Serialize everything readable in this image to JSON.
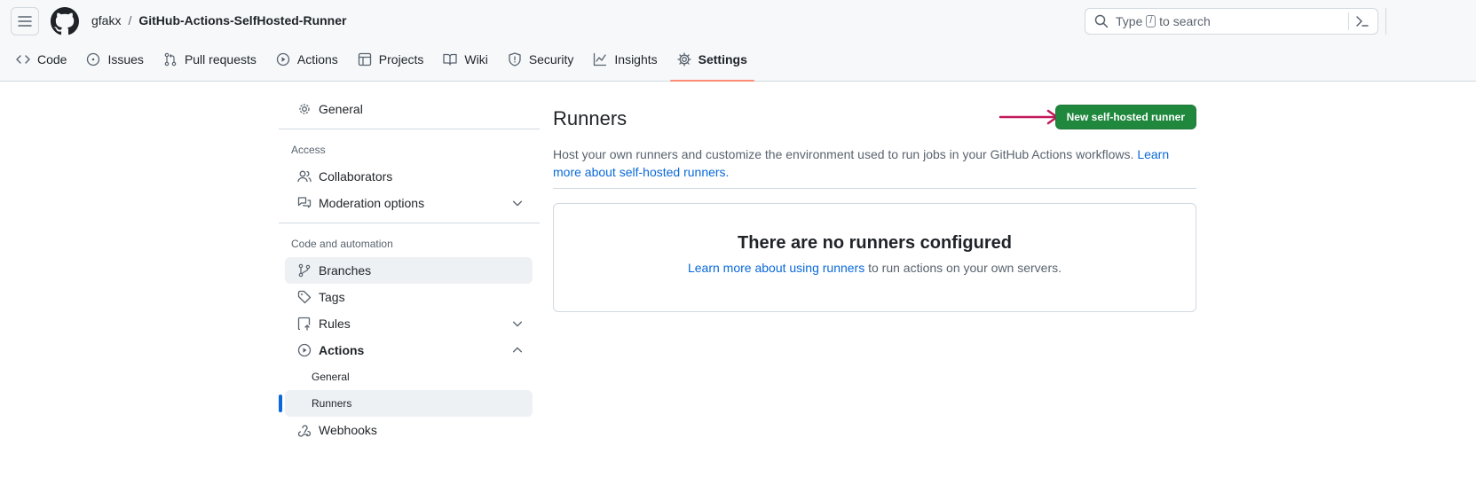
{
  "header": {
    "owner": "gfakx",
    "separator": "/",
    "repo": "GitHub-Actions-SelfHosted-Runner",
    "search": {
      "prefix": "Type",
      "key": "/",
      "suffix": "to search"
    }
  },
  "tabs": [
    {
      "label": "Code",
      "icon": "code-icon"
    },
    {
      "label": "Issues",
      "icon": "issue-icon"
    },
    {
      "label": "Pull requests",
      "icon": "pull-request-icon"
    },
    {
      "label": "Actions",
      "icon": "play-icon"
    },
    {
      "label": "Projects",
      "icon": "table-icon"
    },
    {
      "label": "Wiki",
      "icon": "book-icon"
    },
    {
      "label": "Security",
      "icon": "shield-icon"
    },
    {
      "label": "Insights",
      "icon": "graph-icon"
    },
    {
      "label": "Settings",
      "icon": "gear-icon",
      "active": true
    }
  ],
  "sidebar": {
    "general": "General",
    "access_heading": "Access",
    "collaborators": "Collaborators",
    "moderation": "Moderation options",
    "code_heading": "Code and automation",
    "branches": "Branches",
    "tags": "Tags",
    "rules": "Rules",
    "actions": "Actions",
    "actions_general": "General",
    "actions_runners": "Runners",
    "webhooks": "Webhooks"
  },
  "main": {
    "title": "Runners",
    "new_button": "New self-hosted runner",
    "description": "Host your own runners and customize the environment used to run jobs in your GitHub Actions workflows.",
    "description_link": "Learn more about self-hosted runners.",
    "empty_title": "There are no runners configured",
    "empty_link": "Learn more about using runners",
    "empty_suffix": "to run actions on your own servers."
  },
  "colors": {
    "primary_button": "#1f883d",
    "link": "#0969da",
    "active_tab_underline": "#fd8c73",
    "annotation_arrow": "#c2185b"
  }
}
